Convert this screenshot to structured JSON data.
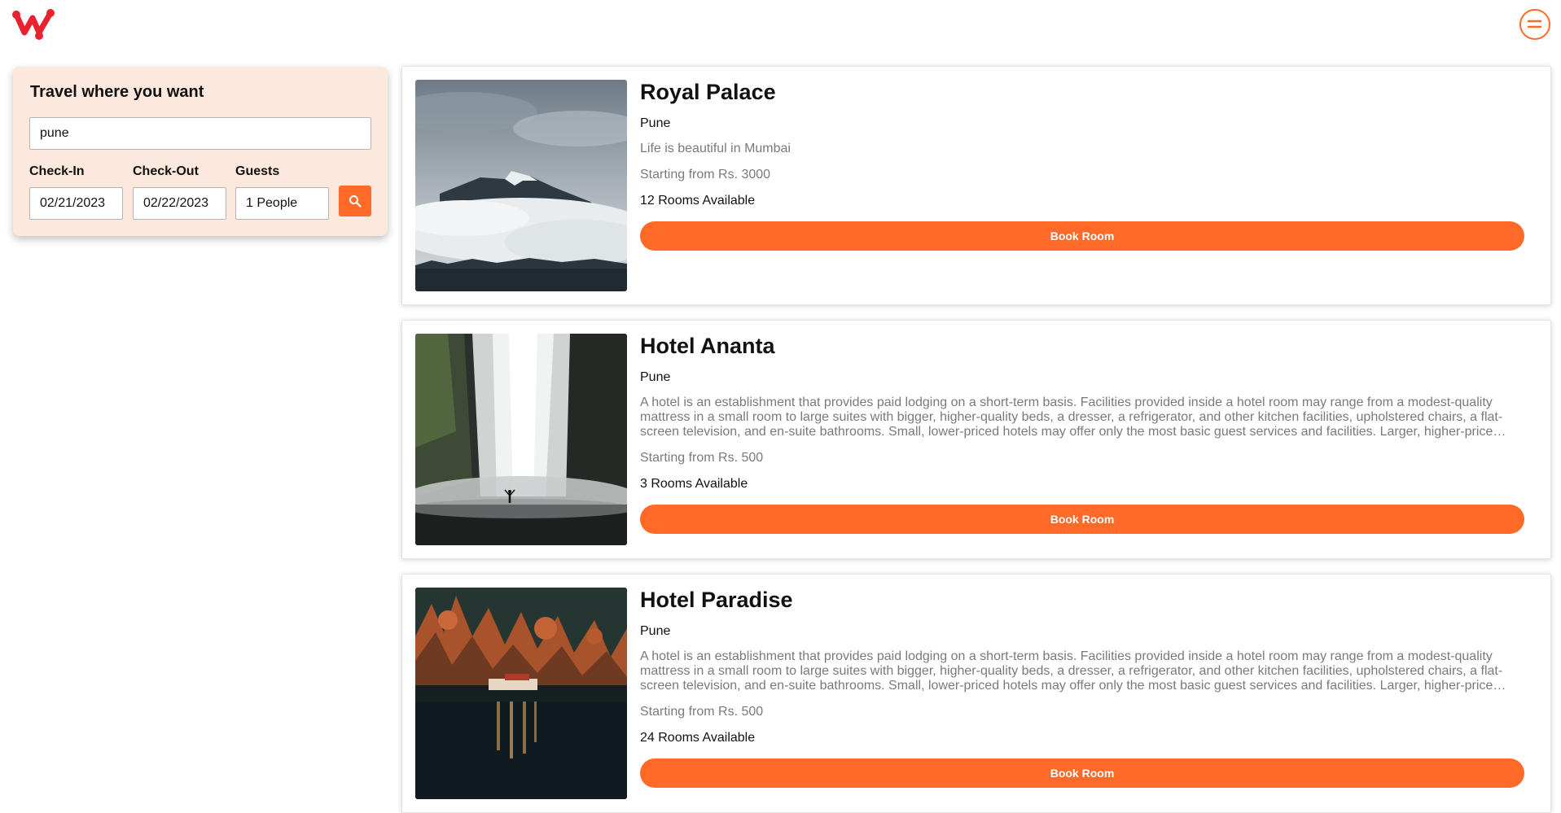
{
  "header": {
    "logo_icon": "w-logo-icon",
    "menu_icon": "menu-circle-icon",
    "brand_color": "#e8222e",
    "accent_color": "#ff6a28"
  },
  "search": {
    "title": "Travel where you want",
    "destination_value": "pune",
    "checkin_label": "Check-In",
    "checkin_value": "02/21/2023",
    "checkout_label": "Check-Out",
    "checkout_value": "02/22/2023",
    "guests_label": "Guests",
    "guests_value": "1 People",
    "search_icon": "search-icon"
  },
  "hotels": [
    {
      "name": "Royal Palace",
      "city": "Pune",
      "description": "Life is beautiful in Mumbai",
      "price": "Starting from Rs. 3000",
      "rooms": "12 Rooms Available",
      "button": "Book Room",
      "image_icon": "mountain-photo"
    },
    {
      "name": "Hotel Ananta",
      "city": "Pune",
      "description": "A hotel is an establishment that provides paid lodging on a short-term basis. Facilities provided inside a hotel room may range from a modest-quality mattress in a small room to large suites with bigger, higher-quality beds, a dresser, a refrigerator, and other kitchen facilities, upholstered chairs, a flat-screen television, and en-suite bathrooms. Small, lower-priced hotels may offer only the most basic guest services and facilities. Larger, higher-priced hotels may provide additional guest facilities.",
      "price": "Starting from Rs. 500",
      "rooms": "3 Rooms Available",
      "button": "Book Room",
      "image_icon": "waterfall-photo"
    },
    {
      "name": "Hotel Paradise",
      "city": "Pune",
      "description": "A hotel is an establishment that provides paid lodging on a short-term basis. Facilities provided inside a hotel room may range from a modest-quality mattress in a small room to large suites with bigger, higher-quality beds, a dresser, a refrigerator, and other kitchen facilities, upholstered chairs, a flat-screen television, and en-suite bathrooms. Small, lower-priced hotels may offer only the most basic guest services and facilities. Larger, higher-priced hotels may provide additional guest facilities.",
      "price": "Starting from Rs. 500",
      "rooms": "24 Rooms Available",
      "button": "Book Room",
      "image_icon": "lake-forest-photo"
    }
  ]
}
